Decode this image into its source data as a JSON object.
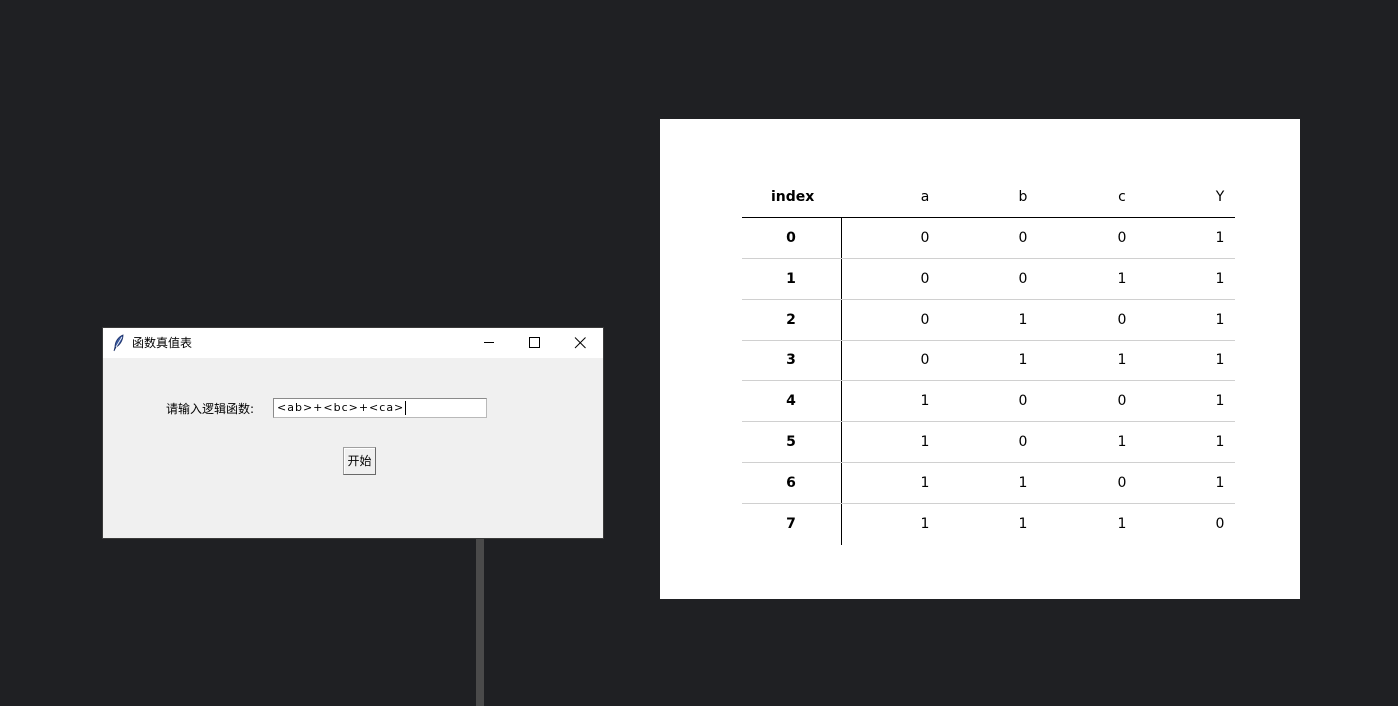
{
  "window": {
    "title": "函数真值表",
    "prompt_label": "请输入逻辑函数:",
    "expression_value": "<ab>+<bc>+<ca>",
    "start_button_label": "开始",
    "icons": {
      "app": "tk-feather-icon",
      "minimize": "minimize-icon",
      "maximize": "maximize-icon",
      "close": "close-icon"
    }
  },
  "table": {
    "columns": [
      "index",
      "a",
      "b",
      "c",
      "Y"
    ],
    "rows": [
      [
        "0",
        "0",
        "0",
        "0",
        "1"
      ],
      [
        "1",
        "0",
        "0",
        "1",
        "1"
      ],
      [
        "2",
        "0",
        "1",
        "0",
        "1"
      ],
      [
        "3",
        "0",
        "1",
        "1",
        "1"
      ],
      [
        "4",
        "1",
        "0",
        "0",
        "1"
      ],
      [
        "5",
        "1",
        "0",
        "1",
        "1"
      ],
      [
        "6",
        "1",
        "1",
        "0",
        "1"
      ],
      [
        "7",
        "1",
        "1",
        "1",
        "0"
      ]
    ]
  }
}
